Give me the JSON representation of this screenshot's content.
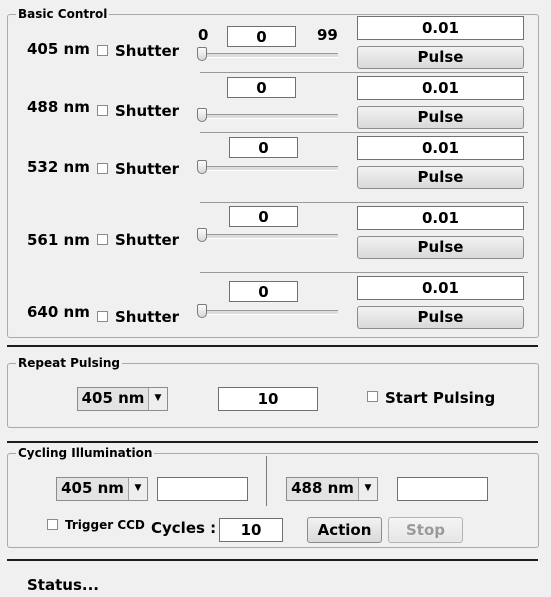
{
  "basic_control": {
    "title": "Basic Control",
    "slider_min_label": "0",
    "slider_max_label": "99",
    "rows": [
      {
        "wavelength": "405 nm",
        "shutter_label": "Shutter",
        "slider_value": "0",
        "duration": "0.01",
        "pulse_label": "Pulse"
      },
      {
        "wavelength": "488 nm",
        "shutter_label": "Shutter",
        "slider_value": "0",
        "duration": "0.01",
        "pulse_label": "Pulse"
      },
      {
        "wavelength": "532 nm",
        "shutter_label": "Shutter",
        "slider_value": "0",
        "duration": "0.01",
        "pulse_label": "Pulse"
      },
      {
        "wavelength": "561 nm",
        "shutter_label": "Shutter",
        "slider_value": "0",
        "duration": "0.01",
        "pulse_label": "Pulse"
      },
      {
        "wavelength": "640 nm",
        "shutter_label": "Shutter",
        "slider_value": "0",
        "duration": "0.01",
        "pulse_label": "Pulse"
      }
    ]
  },
  "repeat_pulsing": {
    "title": "Repeat Pulsing",
    "wavelength_selected": "405 nm",
    "count": "10",
    "start_label": "Start Pulsing"
  },
  "cycling_illumination": {
    "title": "Cycling Illumination",
    "wavelength_a": "405 nm",
    "value_a": "",
    "wavelength_b": "488 nm",
    "value_b": "",
    "trigger_label": "Trigger CCD",
    "cycles_label": "Cycles :",
    "cycles_value": "10",
    "action_label": "Action",
    "stop_label": "Stop"
  },
  "status": {
    "text": "Status..."
  }
}
